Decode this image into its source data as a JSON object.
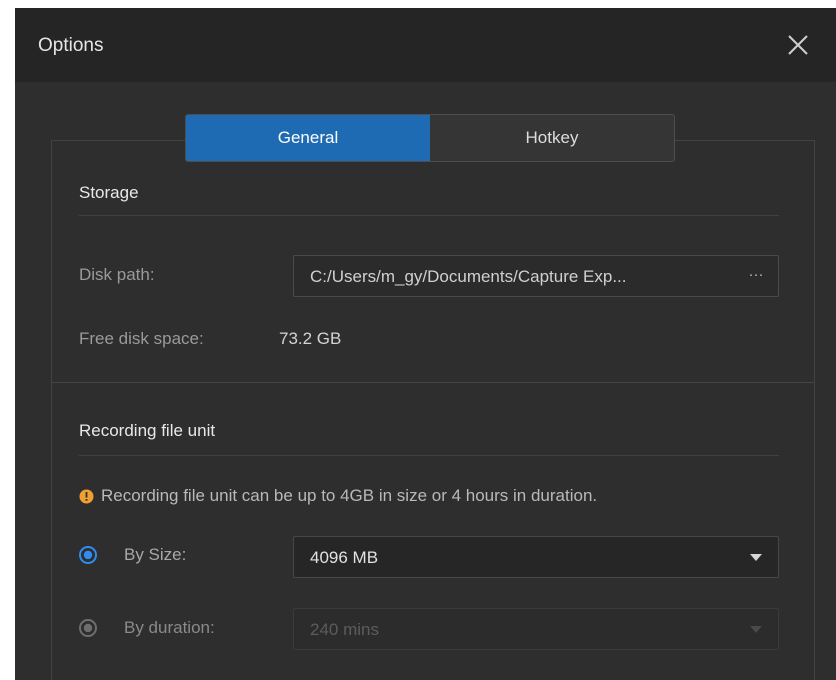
{
  "window": {
    "title": "Options"
  },
  "tabs": [
    {
      "label": "General",
      "active": true
    },
    {
      "label": "Hotkey",
      "active": false
    }
  ],
  "storage": {
    "section_title": "Storage",
    "disk_path_label": "Disk path:",
    "disk_path_value": "C:/Users/m_gy/Documents/Capture Exp...",
    "browse_label": "···",
    "free_space_label": "Free disk space:",
    "free_space_value": "73.2 GB"
  },
  "recording": {
    "section_title": "Recording file unit",
    "notice": "Recording file unit can be up to 4GB in size or 4 hours in duration.",
    "by_size_label": "By Size:",
    "by_size_selected": true,
    "by_size_value": "4096 MB",
    "by_duration_label": "By duration:",
    "by_duration_selected": false,
    "by_duration_value": "240 mins"
  },
  "icons": {
    "close": "close-icon",
    "warning": "warning-icon",
    "caret": "chevron-down-icon"
  },
  "colors": {
    "accent": "#1f6bb3",
    "radio_selected": "#2f8cf0",
    "warning": "#f0a030",
    "window_bg": "#2e2e2e",
    "titlebar_bg": "#252525"
  }
}
